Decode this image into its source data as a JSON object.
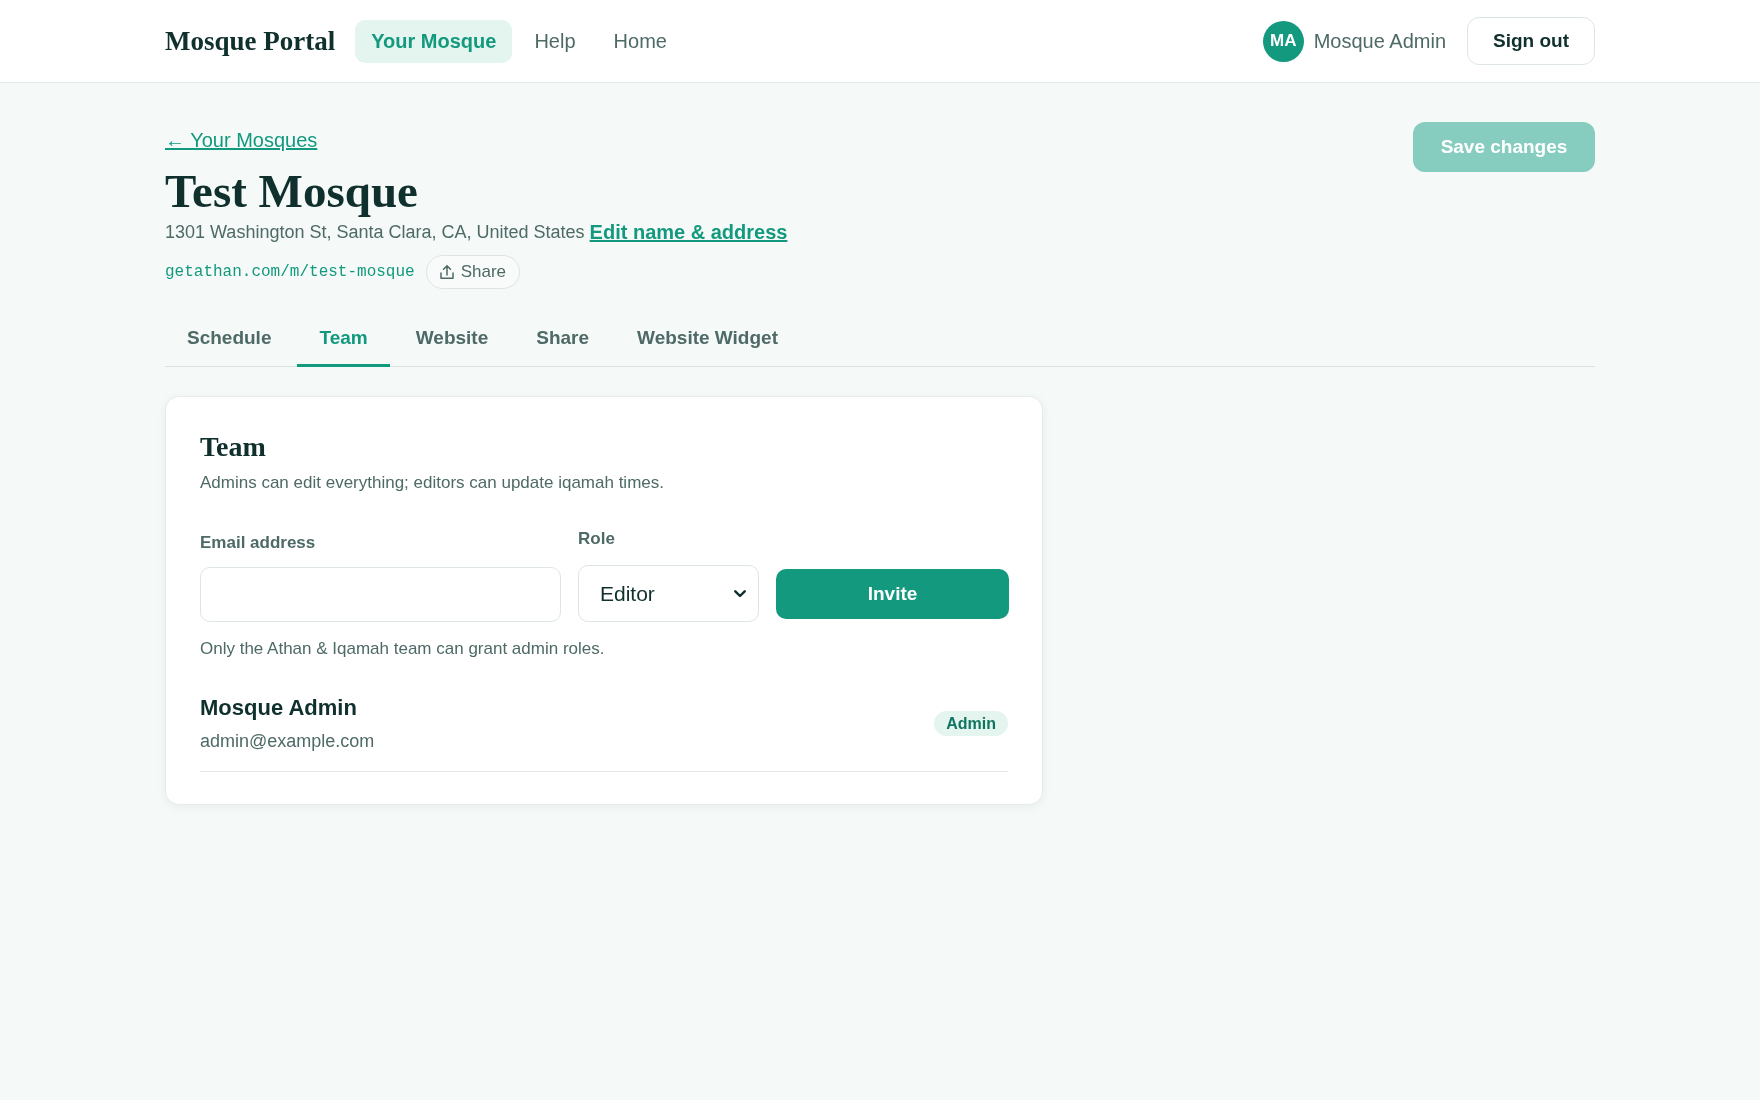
{
  "header": {
    "logo": "Mosque Portal",
    "nav": [
      {
        "label": "Your Mosque",
        "selected": true
      },
      {
        "label": "Help",
        "selected": false
      },
      {
        "label": "Home",
        "selected": false
      }
    ],
    "user": {
      "initials": "MA",
      "name": "Mosque Admin"
    },
    "sign_out": "Sign out"
  },
  "page": {
    "back_link": "← Your Mosques",
    "title": "Test Mosque",
    "address": "1301 Washington St, Santa Clara, CA, United States",
    "edit_link": "Edit name & address",
    "url": "getathan.com/m/test-mosque",
    "share_button": "Share",
    "save_button": {
      "label": "Save changes",
      "disabled": true
    }
  },
  "tabs": [
    {
      "label": "Schedule",
      "selected": false
    },
    {
      "label": "Team",
      "selected": true
    },
    {
      "label": "Website",
      "selected": false
    },
    {
      "label": "Share",
      "selected": false
    },
    {
      "label": "Website Widget",
      "selected": false
    }
  ],
  "team_card": {
    "title": "Team",
    "description": "Admins can edit everything; editors can update iqamah times.",
    "email_field": {
      "label": "Email address"
    },
    "role_field": {
      "label": "Role",
      "value": "Editor"
    },
    "invite_button": "Invite",
    "hint": "Only the Athan & Iqamah team can grant admin roles.",
    "members": [
      {
        "name": "Mosque Admin",
        "email": "admin@example.com",
        "role": "Admin"
      }
    ]
  }
}
